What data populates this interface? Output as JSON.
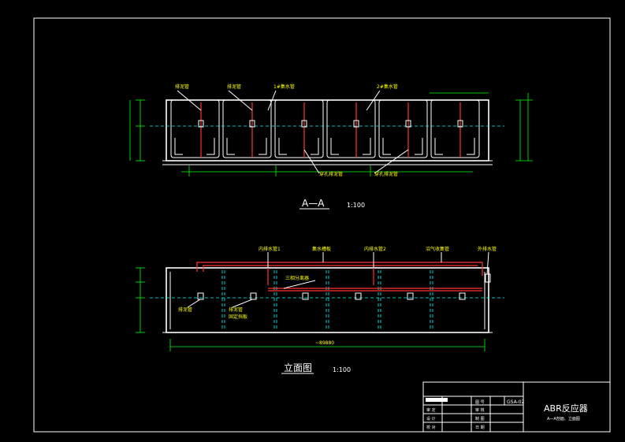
{
  "section_view": {
    "title": "A—A",
    "scale": "1:100",
    "labels": [
      "排泥管",
      "排泥管",
      "1#集水管",
      "2#集水管",
      "穿孔排泥管",
      "穿孔排泥管"
    ]
  },
  "elevation_view": {
    "title": "立面图",
    "scale": "1:100",
    "labels": [
      "内排水管1",
      "集水槽板",
      "内排水管2",
      "沼气收集管",
      "外排水管",
      "三相分离器",
      "排泥管",
      "排泥管",
      "固定挡板"
    ],
    "total_length": "~89880"
  },
  "title_block": {
    "project_title": "ABR反应器",
    "subtitle": "A—A剖面、立面图",
    "drawing_no_label": "图  号",
    "drawing_no": "GSA-02",
    "rows": [
      [
        "",
        "",
        "设  计",
        ""
      ],
      [
        "审  定",
        "",
        "审  核",
        ""
      ],
      [
        "设  计",
        "",
        "制  图",
        ""
      ],
      [
        "校  对",
        "",
        "日  期",
        ""
      ]
    ]
  },
  "colors": {
    "background": "#000000",
    "frame": "#ffffff",
    "dimension": "#00ff00",
    "hidden": "#00ffff",
    "pipe": "#ff3333",
    "label": "#ffff00"
  }
}
